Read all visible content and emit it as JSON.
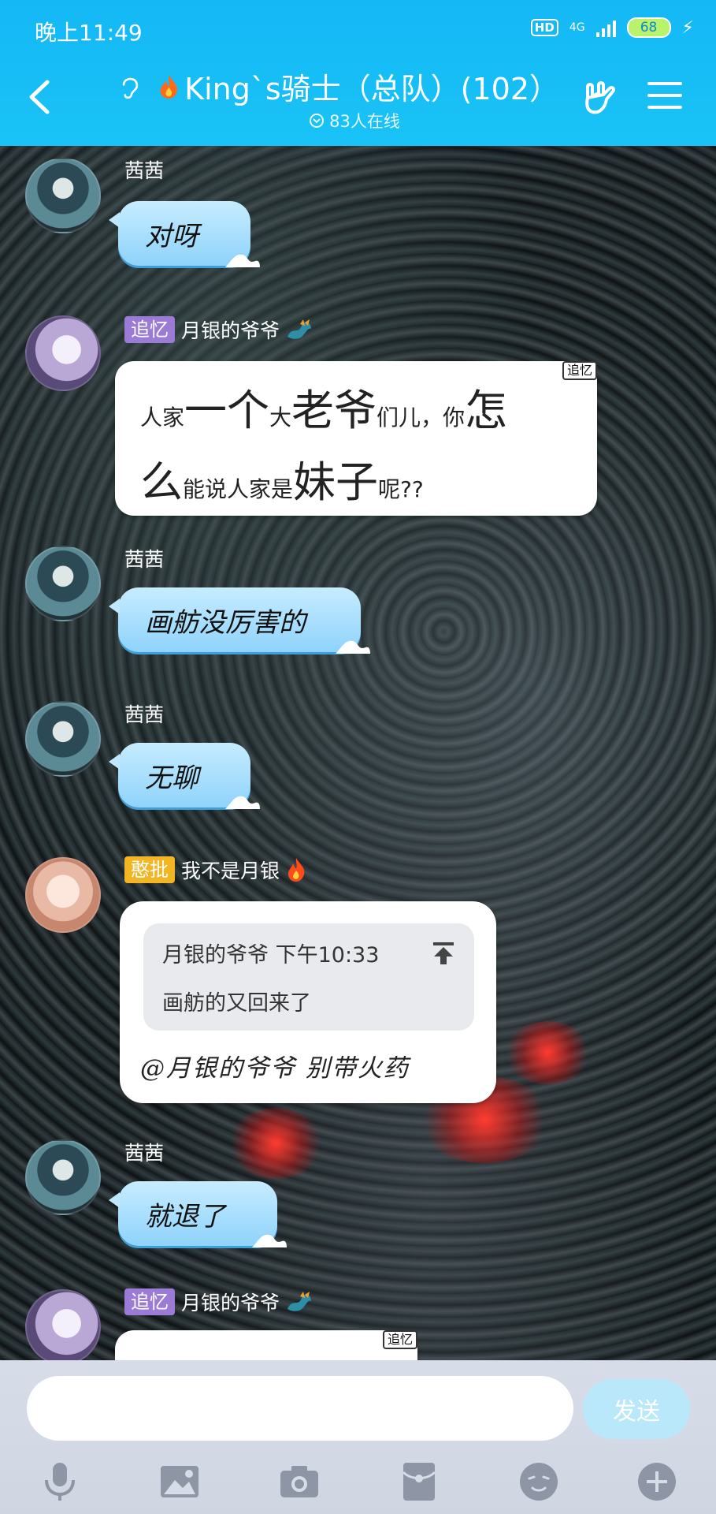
{
  "status_bar": {
    "time": "晚上11:49",
    "hd": "HD",
    "network": "4G",
    "battery": "68"
  },
  "header": {
    "title": "King`s骑士（总队）(102）",
    "online": "83人在线"
  },
  "messages": [
    {
      "sender": "茜茜",
      "text": "对呀"
    },
    {
      "tag": "追忆",
      "sender": "月银的爷爷",
      "badge": "追忆",
      "segments": [
        "人家",
        "一个",
        "大",
        "老爷",
        "们儿，你",
        "怎",
        "么",
        "能说人家是",
        "妹子",
        "呢??"
      ]
    },
    {
      "sender": "茜茜",
      "text": "画舫没厉害的"
    },
    {
      "sender": "茜茜",
      "text": "无聊"
    },
    {
      "tag": "憨批",
      "sender": "我不是月银",
      "quote_head": "月银的爷爷 下午10:33",
      "quote_body": "画舫的又回来了",
      "text": "@月银的爷爷 别带火药"
    },
    {
      "sender": "茜茜",
      "text": "就退了"
    },
    {
      "tag": "追忆",
      "sender": "月银的爷爷",
      "badge": "追忆"
    }
  ],
  "input": {
    "placeholder": "",
    "send_label": "发送"
  },
  "toolbar_icons": [
    "microphone-icon",
    "image-icon",
    "camera-icon",
    "red-packet-icon",
    "emoji-icon",
    "plus-icon"
  ],
  "colors": {
    "header": "#19c3f7",
    "bubble_blue": "#8fd3fb",
    "tag_purple": "#9b7bd6",
    "tag_yellow": "#f2b624",
    "send_button": "#b9e8fb"
  }
}
